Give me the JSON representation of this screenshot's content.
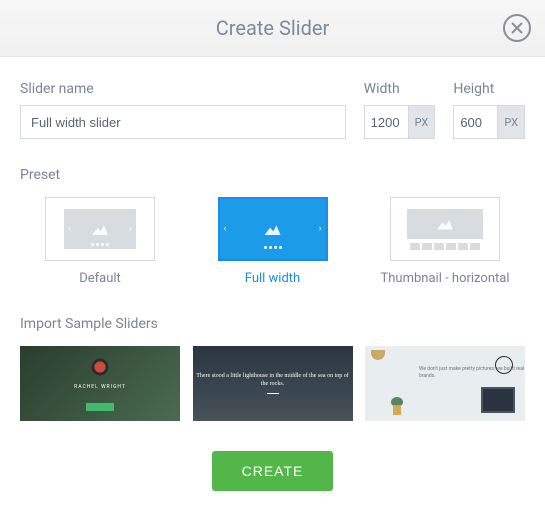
{
  "header": {
    "title": "Create Slider"
  },
  "form": {
    "name_label": "Slider name",
    "name_value": "Full width slider",
    "width_label": "Width",
    "width_value": "1200",
    "height_label": "Height",
    "height_value": "600",
    "unit": "PX"
  },
  "preset": {
    "label": "Preset",
    "items": [
      {
        "label": "Default"
      },
      {
        "label": "Full width"
      },
      {
        "label": "Thumbnail - horizontal"
      }
    ],
    "selected_index": 1
  },
  "import": {
    "label": "Import Sample Sliders",
    "samples": [
      {
        "title": "RACHEL WRIGHT"
      },
      {
        "title": "There stood a little lighthouse in the middle\nof the sea on top of the rocks."
      },
      {
        "title": "We don't just make pretty pictures,\nwe build real brands."
      }
    ]
  },
  "actions": {
    "create_label": "CREATE"
  }
}
